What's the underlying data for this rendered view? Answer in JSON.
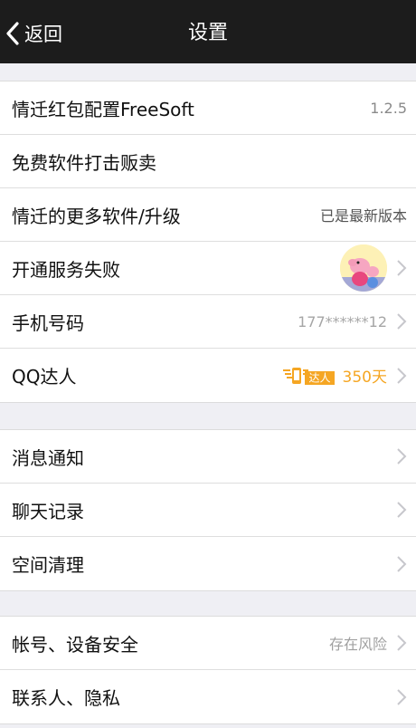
{
  "nav": {
    "back_label": "返回",
    "title": "设置"
  },
  "group1": [
    {
      "label": "情迁红包配置FreeSoft",
      "value": "1.2.5"
    },
    {
      "label": "免费软件打击贩卖",
      "value": ""
    },
    {
      "label": "情迁的更多软件/升级",
      "value": "已是最新版本"
    },
    {
      "label": "开通服务失败",
      "value": ""
    },
    {
      "label": "手机号码",
      "value": "177******12"
    },
    {
      "label": "QQ达人",
      "badge": "达人",
      "days": "350天"
    }
  ],
  "group2": [
    {
      "label": "消息通知"
    },
    {
      "label": "聊天记录"
    },
    {
      "label": "空间清理"
    }
  ],
  "group3": [
    {
      "label": "帐号、设备安全",
      "value": "存在风险"
    },
    {
      "label": "联系人、隐私"
    }
  ],
  "colors": {
    "navbar": "#1c1c1c",
    "background": "#efeff4",
    "qq_gold": "#f5a623"
  },
  "icons": {
    "back": "chevron-left-icon",
    "row_arrow": "chevron-right-icon",
    "avatar": "peppa-pig-avatar",
    "qq_talent": "qq-talent-phone-wings-icon"
  }
}
